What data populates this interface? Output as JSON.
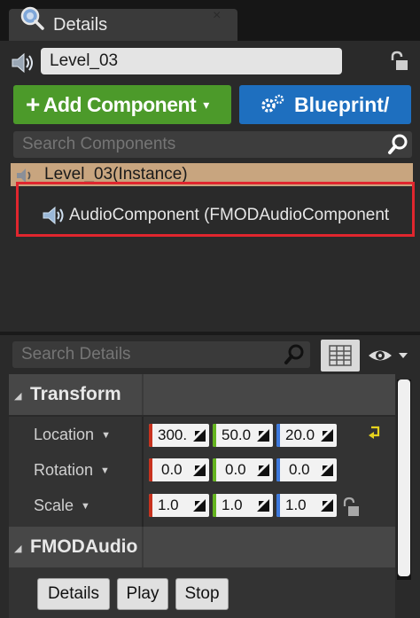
{
  "tab": {
    "title": "Details",
    "close_glyph": "×",
    "icon": "details-magnifier-icon"
  },
  "actor": {
    "name": "Level_03"
  },
  "toolbar": {
    "add_component_label": "Add Component",
    "add_plus": "+",
    "add_caret": "▾",
    "blueprint_label": "Blueprint/",
    "add_color": "#4c9a2a",
    "blueprint_color": "#1e6fbf"
  },
  "components": {
    "search_placeholder": "Search Components",
    "root_label": "Level_03(Instance)",
    "child_label": "AudioComponent (FMODAudioComponent",
    "highlight_color": "#e0262e"
  },
  "details": {
    "search_placeholder": "Search Details",
    "sections": [
      {
        "label": "Transform"
      },
      {
        "label": "FMODAudio"
      }
    ],
    "properties": [
      {
        "label": "Location",
        "values": [
          "300.",
          "50.0",
          "20.0"
        ]
      },
      {
        "label": "Rotation",
        "values": [
          "0.0",
          "0.0",
          "0.0"
        ]
      },
      {
        "label": "Scale",
        "values": [
          "1.0",
          "1.0",
          "1.0"
        ]
      }
    ],
    "axis_colors": [
      "#c8321e",
      "#64b41e",
      "#3c78dc"
    ],
    "buttons": [
      "Details",
      "Play",
      "Stop"
    ]
  },
  "glyphs": {
    "caret": "▼",
    "collapse_arrow": "◢"
  }
}
